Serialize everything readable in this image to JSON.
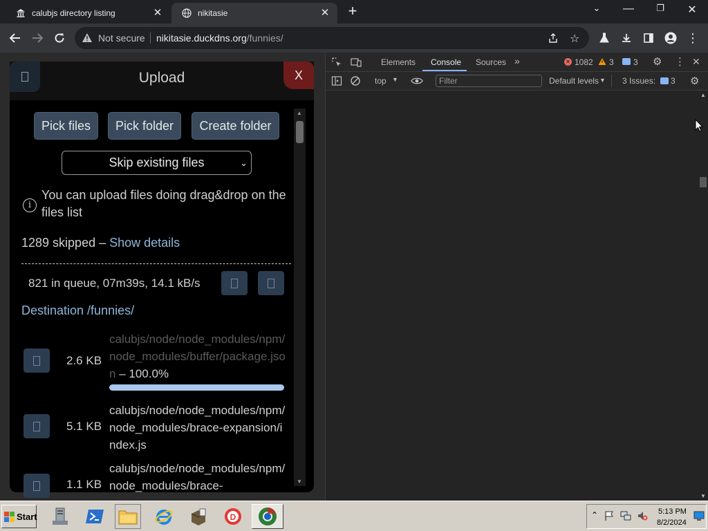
{
  "browser": {
    "tabs": [
      {
        "title": "calubjs directory listing"
      },
      {
        "title": "nikitasie"
      }
    ],
    "address": {
      "security": "Not secure",
      "host": "nikitasie.duckdns.org",
      "path": "/funnies/"
    }
  },
  "upload": {
    "title": "Upload",
    "close_label": "X",
    "pick_files": "Pick files",
    "pick_folder": "Pick folder",
    "create_folder": "Create folder",
    "mode_selected": "Skip existing files",
    "info": "You can upload files doing drag&drop on the files list",
    "skipped_count": "1289 skipped –",
    "show_details": "Show details",
    "queue_status": "821 in queue, 07m39s, 14.1 kB/s",
    "destination": "Destination /funnies/",
    "files": [
      {
        "size": "2.6 KB",
        "name": "calubjs/node/node_modules/npm/node_modules/buffer/package.json",
        "progress_text": "– 100.0%",
        "progress": 1.0
      },
      {
        "size": "5.1 KB",
        "name": "calubjs/node/node_modules/npm/node_modules/brace-expansion/index.js"
      },
      {
        "size": "1.1 KB",
        "name": "calubjs/node/node_modules/npm/node_modules/brace-"
      }
    ]
  },
  "devtools": {
    "tabs": [
      "Elements",
      "Console",
      "Sources"
    ],
    "active_tab": "Console",
    "errors": "1082",
    "warnings": "3",
    "messages": "3",
    "context": "top",
    "filter_placeholder": "Filter",
    "levels": "Default levels",
    "issues_label": "3 Issues:",
    "issues_count": "3"
  },
  "taskbar": {
    "start": "Start",
    "time": "5:13 PM",
    "date": "8/2/2024"
  },
  "colors": {
    "accent_link": "#8fb6d8",
    "button": "#3a4a5c",
    "close": "#6d1b1b",
    "error": "#e46962",
    "warning": "#f29900",
    "info": "#8ab4f8"
  }
}
